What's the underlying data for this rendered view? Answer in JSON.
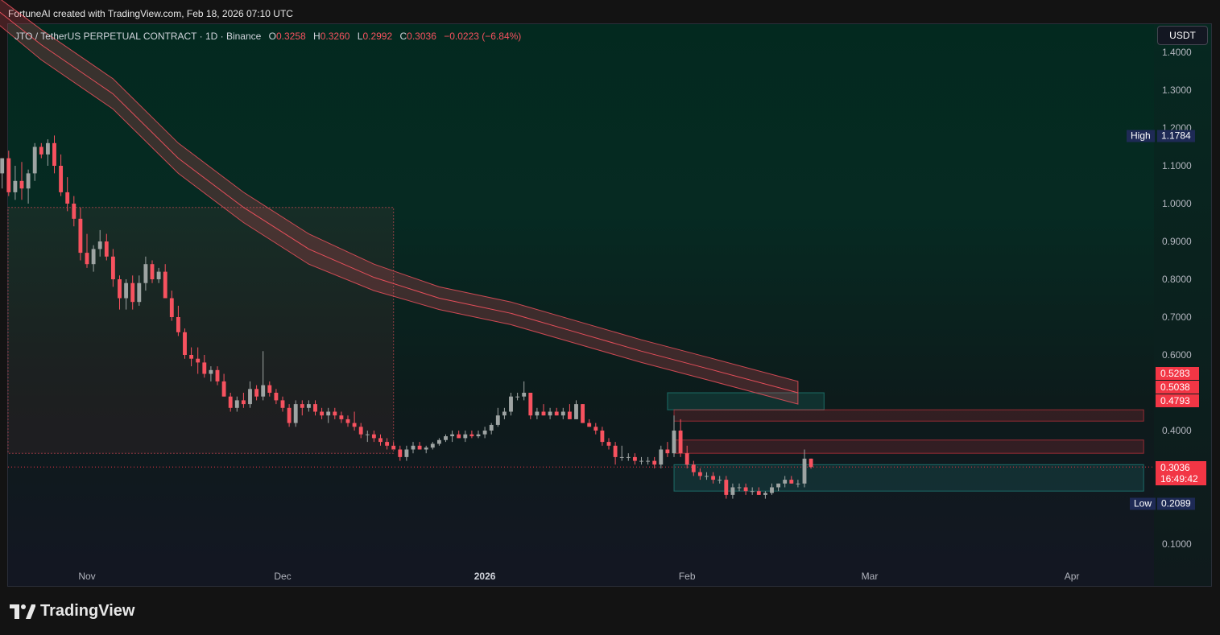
{
  "header": {
    "credit": "FortuneAI created with TradingView.com, Feb 18, 2026 07:10 UTC"
  },
  "legend": {
    "symbol": "JTO / TetherUS PERPETUAL CONTRACT · 1D · Binance",
    "o_label": "O",
    "o_value": "0.3258",
    "h_label": "H",
    "h_value": "0.3260",
    "l_label": "L",
    "l_value": "0.2992",
    "c_label": "C",
    "c_value": "0.3036",
    "change": "−0.0223 (−6.84%)"
  },
  "currency_button": "USDT",
  "high_marker": {
    "label": "High",
    "value": "1.1784"
  },
  "low_marker": {
    "label": "Low",
    "value": "0.2089"
  },
  "price_tags": [
    "0.5283",
    "0.5038",
    "0.4793"
  ],
  "last_price": {
    "value": "0.3036",
    "countdown": "16:49:42"
  },
  "brand": {
    "name": "TradingView"
  },
  "colors": {
    "up": "#9ea4a3",
    "down": "#f7525f",
    "band": "#f7525f",
    "accent": "#f23645"
  },
  "chart_data": {
    "type": "candlestick",
    "symbol": "JTO / TetherUS PERPETUAL CONTRACT",
    "interval": "1D",
    "exchange": "Binance",
    "y_ticks": [
      "1.4000",
      "1.3000",
      "1.2000",
      "1.1000",
      "1.0000",
      "0.9000",
      "0.8000",
      "0.7000",
      "0.6000",
      "0.4000",
      "0.1000"
    ],
    "x_ticks": [
      {
        "label": "Nov",
        "bold": false
      },
      {
        "label": "Dec",
        "bold": false
      },
      {
        "label": "2026",
        "bold": true
      },
      {
        "label": "Feb",
        "bold": false
      },
      {
        "label": "Mar",
        "bold": false
      },
      {
        "label": "Apr",
        "bold": false
      }
    ],
    "first_date": "2025-10-18",
    "candles": [
      [
        1.12,
        1.17,
        1.06,
        1.08
      ],
      [
        1.08,
        1.12,
        1.04,
        1.12
      ],
      [
        1.12,
        1.14,
        1.02,
        1.03
      ],
      [
        1.03,
        1.1,
        1.01,
        1.06
      ],
      [
        1.06,
        1.11,
        1.01,
        1.04
      ],
      [
        1.04,
        1.09,
        1.0,
        1.08
      ],
      [
        1.08,
        1.16,
        1.06,
        1.15
      ],
      [
        1.15,
        1.16,
        1.12,
        1.13
      ],
      [
        1.13,
        1.17,
        1.1,
        1.16
      ],
      [
        1.16,
        1.18,
        1.08,
        1.1
      ],
      [
        1.1,
        1.13,
        1.02,
        1.03
      ],
      [
        1.03,
        1.07,
        0.98,
        1.0
      ],
      [
        1.0,
        1.02,
        0.94,
        0.96
      ],
      [
        0.96,
        0.99,
        0.85,
        0.87
      ],
      [
        0.87,
        0.92,
        0.83,
        0.84
      ],
      [
        0.84,
        0.89,
        0.82,
        0.88
      ],
      [
        0.88,
        0.93,
        0.86,
        0.9
      ],
      [
        0.9,
        0.92,
        0.85,
        0.86
      ],
      [
        0.86,
        0.88,
        0.78,
        0.8
      ],
      [
        0.8,
        0.81,
        0.72,
        0.75
      ],
      [
        0.75,
        0.8,
        0.72,
        0.79
      ],
      [
        0.79,
        0.81,
        0.72,
        0.74
      ],
      [
        0.74,
        0.81,
        0.73,
        0.79
      ],
      [
        0.79,
        0.86,
        0.77,
        0.84
      ],
      [
        0.84,
        0.85,
        0.79,
        0.8
      ],
      [
        0.8,
        0.83,
        0.79,
        0.82
      ],
      [
        0.82,
        0.84,
        0.75,
        0.75
      ],
      [
        0.75,
        0.77,
        0.69,
        0.7
      ],
      [
        0.7,
        0.73,
        0.65,
        0.66
      ],
      [
        0.66,
        0.67,
        0.59,
        0.6
      ],
      [
        0.6,
        0.62,
        0.57,
        0.59
      ],
      [
        0.59,
        0.62,
        0.55,
        0.58
      ],
      [
        0.58,
        0.6,
        0.54,
        0.55
      ],
      [
        0.55,
        0.57,
        0.53,
        0.56
      ],
      [
        0.56,
        0.57,
        0.52,
        0.53
      ],
      [
        0.53,
        0.55,
        0.49,
        0.49
      ],
      [
        0.49,
        0.5,
        0.45,
        0.46
      ],
      [
        0.46,
        0.49,
        0.45,
        0.48
      ],
      [
        0.48,
        0.5,
        0.46,
        0.47
      ],
      [
        0.47,
        0.53,
        0.46,
        0.51
      ],
      [
        0.51,
        0.52,
        0.48,
        0.49
      ],
      [
        0.49,
        0.61,
        0.48,
        0.52
      ],
      [
        0.52,
        0.53,
        0.49,
        0.5
      ],
      [
        0.5,
        0.51,
        0.47,
        0.48
      ],
      [
        0.48,
        0.49,
        0.45,
        0.46
      ],
      [
        0.46,
        0.47,
        0.41,
        0.42
      ],
      [
        0.42,
        0.48,
        0.41,
        0.47
      ],
      [
        0.47,
        0.48,
        0.44,
        0.46
      ],
      [
        0.46,
        0.48,
        0.45,
        0.47
      ],
      [
        0.47,
        0.48,
        0.44,
        0.45
      ],
      [
        0.45,
        0.46,
        0.43,
        0.44
      ],
      [
        0.44,
        0.46,
        0.42,
        0.45
      ],
      [
        0.45,
        0.46,
        0.43,
        0.44
      ],
      [
        0.44,
        0.45,
        0.42,
        0.43
      ],
      [
        0.43,
        0.44,
        0.41,
        0.42
      ],
      [
        0.42,
        0.45,
        0.4,
        0.41
      ],
      [
        0.41,
        0.42,
        0.38,
        0.39
      ],
      [
        0.39,
        0.4,
        0.37,
        0.39
      ],
      [
        0.39,
        0.4,
        0.37,
        0.38
      ],
      [
        0.38,
        0.39,
        0.36,
        0.37
      ],
      [
        0.37,
        0.38,
        0.35,
        0.36
      ],
      [
        0.36,
        0.37,
        0.35,
        0.35
      ],
      [
        0.35,
        0.36,
        0.32,
        0.33
      ],
      [
        0.33,
        0.36,
        0.32,
        0.35
      ],
      [
        0.35,
        0.37,
        0.34,
        0.36
      ],
      [
        0.36,
        0.37,
        0.35,
        0.35
      ],
      [
        0.35,
        0.36,
        0.34,
        0.355
      ],
      [
        0.355,
        0.37,
        0.35,
        0.365
      ],
      [
        0.365,
        0.38,
        0.36,
        0.375
      ],
      [
        0.375,
        0.39,
        0.37,
        0.385
      ],
      [
        0.385,
        0.4,
        0.37,
        0.39
      ],
      [
        0.39,
        0.4,
        0.38,
        0.38
      ],
      [
        0.38,
        0.4,
        0.37,
        0.39
      ],
      [
        0.39,
        0.4,
        0.38,
        0.385
      ],
      [
        0.385,
        0.4,
        0.38,
        0.39
      ],
      [
        0.39,
        0.41,
        0.38,
        0.4
      ],
      [
        0.4,
        0.42,
        0.39,
        0.415
      ],
      [
        0.415,
        0.46,
        0.41,
        0.44
      ],
      [
        0.44,
        0.46,
        0.43,
        0.45
      ],
      [
        0.45,
        0.5,
        0.44,
        0.49
      ],
      [
        0.49,
        0.5,
        0.48,
        0.49
      ],
      [
        0.49,
        0.53,
        0.48,
        0.5
      ],
      [
        0.5,
        0.5,
        0.43,
        0.44
      ],
      [
        0.44,
        0.46,
        0.43,
        0.45
      ],
      [
        0.45,
        0.47,
        0.44,
        0.44
      ],
      [
        0.44,
        0.46,
        0.43,
        0.45
      ],
      [
        0.45,
        0.46,
        0.44,
        0.44
      ],
      [
        0.44,
        0.46,
        0.43,
        0.45
      ],
      [
        0.45,
        0.47,
        0.43,
        0.43
      ],
      [
        0.43,
        0.48,
        0.43,
        0.47
      ],
      [
        0.47,
        0.47,
        0.42,
        0.42
      ],
      [
        0.42,
        0.43,
        0.41,
        0.41
      ],
      [
        0.41,
        0.42,
        0.39,
        0.4
      ],
      [
        0.4,
        0.41,
        0.36,
        0.37
      ],
      [
        0.37,
        0.38,
        0.35,
        0.36
      ],
      [
        0.36,
        0.37,
        0.31,
        0.33
      ],
      [
        0.33,
        0.36,
        0.32,
        0.33
      ],
      [
        0.33,
        0.34,
        0.32,
        0.33
      ],
      [
        0.33,
        0.34,
        0.31,
        0.32
      ],
      [
        0.32,
        0.33,
        0.31,
        0.32
      ],
      [
        0.32,
        0.33,
        0.31,
        0.32
      ],
      [
        0.32,
        0.33,
        0.3,
        0.31
      ],
      [
        0.31,
        0.36,
        0.3,
        0.35
      ],
      [
        0.35,
        0.37,
        0.33,
        0.34
      ],
      [
        0.34,
        0.44,
        0.33,
        0.4
      ],
      [
        0.4,
        0.43,
        0.33,
        0.34
      ],
      [
        0.34,
        0.36,
        0.3,
        0.31
      ],
      [
        0.31,
        0.32,
        0.28,
        0.29
      ],
      [
        0.29,
        0.3,
        0.27,
        0.28
      ],
      [
        0.28,
        0.29,
        0.27,
        0.28
      ],
      [
        0.28,
        0.29,
        0.26,
        0.27
      ],
      [
        0.27,
        0.28,
        0.26,
        0.27
      ],
      [
        0.27,
        0.28,
        0.22,
        0.23
      ],
      [
        0.23,
        0.26,
        0.22,
        0.25
      ],
      [
        0.25,
        0.26,
        0.24,
        0.25
      ],
      [
        0.25,
        0.26,
        0.23,
        0.24
      ],
      [
        0.24,
        0.25,
        0.23,
        0.24
      ],
      [
        0.24,
        0.25,
        0.23,
        0.23
      ],
      [
        0.23,
        0.24,
        0.22,
        0.235
      ],
      [
        0.235,
        0.26,
        0.23,
        0.25
      ],
      [
        0.25,
        0.26,
        0.24,
        0.26
      ],
      [
        0.26,
        0.28,
        0.25,
        0.27
      ],
      [
        0.27,
        0.28,
        0.26,
        0.26
      ],
      [
        0.26,
        0.27,
        0.25,
        0.26
      ],
      [
        0.26,
        0.35,
        0.25,
        0.3258
      ],
      [
        0.3258,
        0.326,
        0.2992,
        0.3036
      ]
    ],
    "moving_average_band": [
      [
        "2025-10-18",
        1.48,
        1.55
      ],
      [
        "2025-10-25",
        1.38,
        1.46
      ],
      [
        "2025-11-05",
        1.25,
        1.33
      ],
      [
        "2025-11-15",
        1.08,
        1.16
      ],
      [
        "2025-11-25",
        0.95,
        1.03
      ],
      [
        "2025-12-05",
        0.84,
        0.92
      ],
      [
        "2025-12-15",
        0.77,
        0.84
      ],
      [
        "2025-12-25",
        0.72,
        0.78
      ],
      [
        "2026-01-05",
        0.68,
        0.74
      ],
      [
        "2026-01-15",
        0.63,
        0.69
      ],
      [
        "2026-01-25",
        0.58,
        0.64
      ],
      [
        "2026-02-05",
        0.53,
        0.59
      ],
      [
        "2026-02-18",
        0.47,
        0.53
      ]
    ],
    "zones": [
      {
        "from": "2025-10-18",
        "to": "2025-12-18",
        "low": 0.34,
        "high": 0.99,
        "color": "#f7525f"
      },
      {
        "from": "2026-01-29",
        "to": "2026-02-22",
        "low": 0.455,
        "high": 0.5,
        "color": "#26a69a"
      },
      {
        "from": "2026-01-30",
        "to": "2026-04-12",
        "low": 0.425,
        "high": 0.455,
        "color": "#f23645"
      },
      {
        "from": "2026-01-30",
        "to": "2026-04-12",
        "low": 0.34,
        "high": 0.375,
        "color": "#f23645"
      },
      {
        "from": "2026-01-30",
        "to": "2026-04-12",
        "low": 0.24,
        "high": 0.31,
        "color": "#26a69a"
      }
    ],
    "high": 1.1784,
    "low": 0.2089,
    "last": 0.3036
  }
}
